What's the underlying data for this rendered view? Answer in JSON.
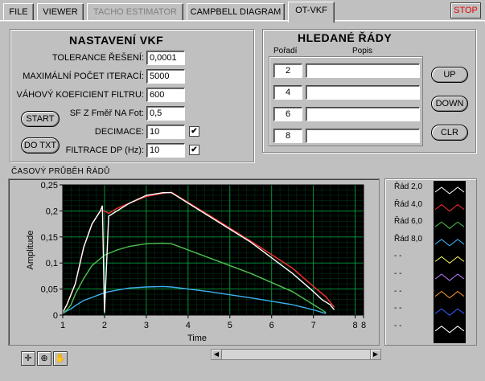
{
  "tabs": [
    {
      "label": "FILE",
      "state": "normal"
    },
    {
      "label": "VIEWER",
      "state": "normal"
    },
    {
      "label": "TACHO ESTIMATOR",
      "state": "disabled"
    },
    {
      "label": "CAMPBELL DIAGRAM",
      "state": "normal"
    },
    {
      "label": "OT-VKF",
      "state": "active"
    }
  ],
  "stop_label": "STOP",
  "settings": {
    "title": "NASTAVENÍ VKF",
    "tolerance_label": "TOLERANCE ŘEŠENÍ:",
    "tolerance_value": "0,0001",
    "max_iter_label": "MAXIMÁLNÍ POČET ITERACÍ:",
    "max_iter_value": "5000",
    "weight_label": "VÁHOVÝ KOEFICIENT FILTRU:",
    "weight_value": "600",
    "sf_label": "SF Z Fměř NA Fot:",
    "sf_value": "0,5",
    "decimation_label": "DECIMACE:",
    "decimation_value": "10",
    "decimation_checked": true,
    "filter_label": "FILTRACE DP (Hz):",
    "filter_value": "10",
    "filter_checked": true,
    "start_label": "START",
    "do_txt_label": "DO TXT"
  },
  "orders": {
    "title": "HLEDANÉ ŘÁDY",
    "col_order": "Pořadí",
    "col_desc": "Popis",
    "rows": [
      {
        "order": "2",
        "desc": ""
      },
      {
        "order": "4",
        "desc": ""
      },
      {
        "order": "6",
        "desc": ""
      },
      {
        "order": "8",
        "desc": ""
      }
    ],
    "up_label": "UP",
    "down_label": "DOWN",
    "clr_label": "CLR"
  },
  "graph_section_label": "ČASOVÝ PRŮBĚH ŘÁDŮ",
  "colors": {
    "plot_bg": "#000000",
    "grid": "#00a040",
    "order2": "#ffffff",
    "order4": "#ff3030",
    "order6": "#50c050",
    "order8": "#40b0f0"
  },
  "chart_data": {
    "type": "line",
    "xlabel": "Time",
    "ylabel": "Amplitude",
    "xlim": [
      1,
      8.2
    ],
    "ylim": [
      0,
      0.25
    ],
    "x_ticks": [
      "1",
      "2",
      "3",
      "4",
      "5",
      "6",
      "7",
      "8",
      "8"
    ],
    "y_ticks": [
      "0",
      "0,05",
      "0,1",
      "0,15",
      "0,2",
      "0,25"
    ],
    "grid": true,
    "series": [
      {
        "name": "Řád 2,0",
        "x": [
          1.0,
          1.1,
          1.2,
          1.3,
          1.5,
          1.7,
          1.9,
          1.95,
          2.0,
          2.1,
          2.3,
          2.6,
          3.0,
          3.4,
          3.6,
          4.5,
          5.5,
          6.5,
          7.0,
          7.2,
          7.4,
          7.5
        ],
        "y": [
          0.005,
          0.02,
          0.04,
          0.06,
          0.13,
          0.175,
          0.2,
          0.21,
          0.005,
          0.19,
          0.2,
          0.215,
          0.23,
          0.235,
          0.235,
          0.19,
          0.14,
          0.08,
          0.045,
          0.03,
          0.02,
          0.01
        ]
      },
      {
        "name": "Řád 4,0",
        "x": [
          1.0,
          1.1,
          1.2,
          1.3,
          1.5,
          1.7,
          1.9,
          2.0,
          2.1,
          2.3,
          2.6,
          3.0,
          3.4,
          3.6,
          4.5,
          5.5,
          6.5,
          7.0,
          7.3,
          7.5
        ],
        "y": [
          0.005,
          0.02,
          0.04,
          0.06,
          0.13,
          0.175,
          0.2,
          0.2,
          0.195,
          0.205,
          0.215,
          0.228,
          0.234,
          0.236,
          0.192,
          0.142,
          0.09,
          0.055,
          0.035,
          0.015
        ]
      },
      {
        "name": "Řád 6,0",
        "x": [
          1.0,
          1.1,
          1.2,
          1.3,
          1.5,
          1.7,
          2.0,
          2.3,
          2.6,
          3.0,
          3.4,
          3.6,
          4.5,
          5.5,
          6.5,
          7.0,
          7.3
        ],
        "y": [
          0.003,
          0.01,
          0.02,
          0.04,
          0.07,
          0.095,
          0.115,
          0.125,
          0.132,
          0.137,
          0.138,
          0.137,
          0.11,
          0.08,
          0.045,
          0.02,
          0.005
        ]
      },
      {
        "name": "Řád 8,0",
        "x": [
          1.0,
          1.1,
          1.2,
          1.3,
          1.5,
          1.7,
          2.0,
          2.3,
          2.6,
          3.0,
          3.4,
          3.6,
          4.5,
          5.5,
          6.5,
          7.0,
          7.3
        ],
        "y": [
          0.003,
          0.008,
          0.012,
          0.018,
          0.028,
          0.034,
          0.043,
          0.048,
          0.052,
          0.054,
          0.055,
          0.054,
          0.045,
          0.033,
          0.02,
          0.01,
          0.003
        ]
      }
    ]
  },
  "legend": [
    {
      "label": "Řád 2,0",
      "color": "#ffffff"
    },
    {
      "label": "Řád 4,0",
      "color": "#ff3030"
    },
    {
      "label": "Řád 6,0",
      "color": "#50c050"
    },
    {
      "label": "Řád 8,0",
      "color": "#40b0f0"
    },
    {
      "label": "- -",
      "color": "#ffff60"
    },
    {
      "label": "- -",
      "color": "#c080ff"
    },
    {
      "label": "- -",
      "color": "#ffa040"
    },
    {
      "label": "- -",
      "color": "#3060ff"
    },
    {
      "label": "- -",
      "color": "#ffffff"
    }
  ]
}
